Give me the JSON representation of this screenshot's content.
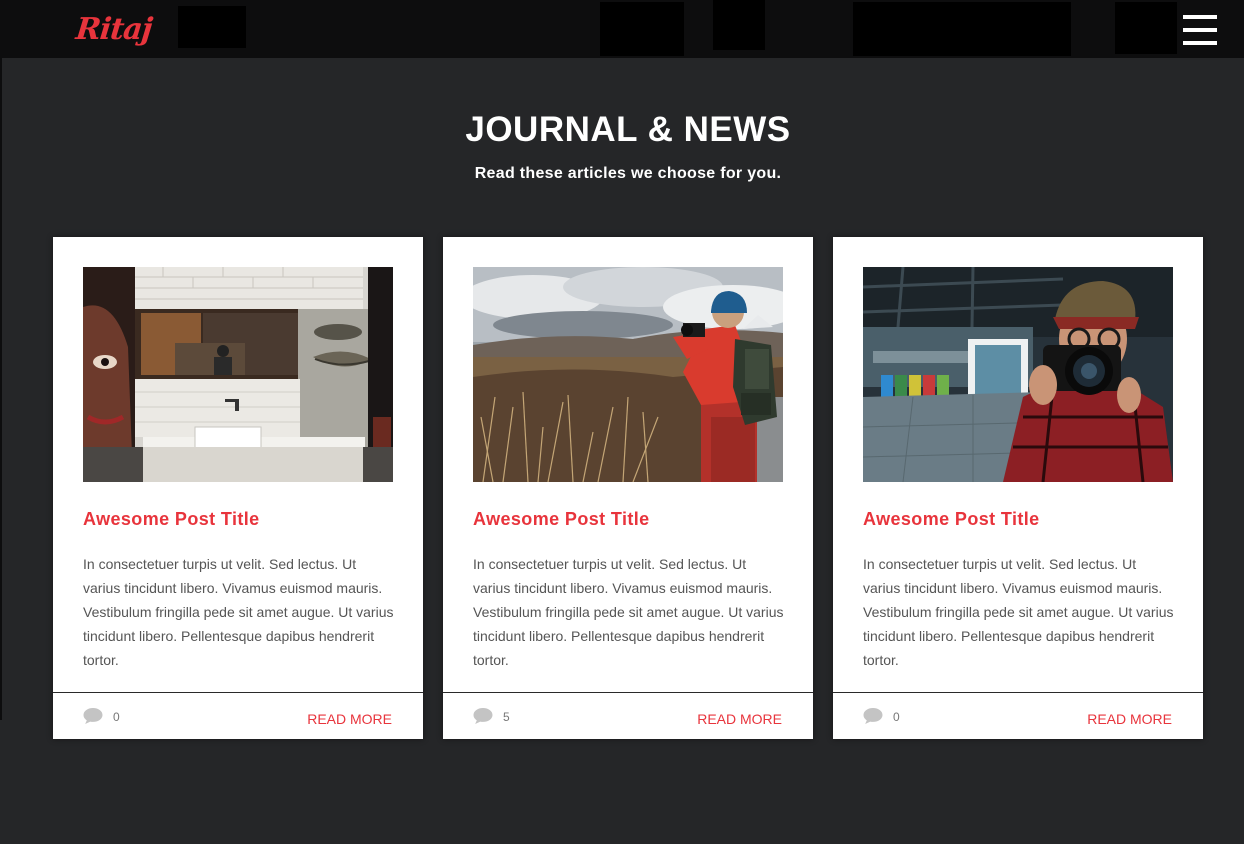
{
  "header": {
    "logo_text": "Ritaj",
    "menu_icon": "hamburger-menu-icon"
  },
  "section": {
    "title": "JOURNAL & NEWS",
    "subtitle": "Read these articles we choose for you."
  },
  "colors": {
    "accent": "#e8343c",
    "background": "#252628",
    "header_bg": "#0d0d0e",
    "card_bg": "#ffffff"
  },
  "posts": [
    {
      "image": "bathroom-mirror-street-art-photo",
      "title": "Awesome Post Title",
      "excerpt": "In consectetuer turpis ut velit. Sed lectus. Ut varius tincidunt libero. Vivamus euismod mauris. Vestibulum fringilla pede sit amet augue. Ut varius tincidunt libero. Pellentesque dapibus hendrerit tortor.",
      "comment_icon": "comment-icon",
      "comments": "0",
      "read_more": "READ MORE"
    },
    {
      "image": "hiker-photographer-field-photo",
      "title": "Awesome Post Title",
      "excerpt": "In consectetuer turpis ut velit. Sed lectus. Ut varius tincidunt libero. Vivamus euismod mauris. Vestibulum fringilla pede sit amet augue. Ut varius tincidunt libero. Pellentesque dapibus hendrerit tortor.",
      "comment_icon": "comment-icon",
      "comments": "5",
      "read_more": "READ MORE"
    },
    {
      "image": "photographer-with-camera-photo",
      "title": "Awesome Post Title",
      "excerpt": "In consectetuer turpis ut velit. Sed lectus. Ut varius tincidunt libero. Vivamus euismod mauris. Vestibulum fringilla pede sit amet augue. Ut varius tincidunt libero. Pellentesque dapibus hendrerit tortor.",
      "comment_icon": "comment-icon",
      "comments": "0",
      "read_more": "READ MORE"
    }
  ]
}
